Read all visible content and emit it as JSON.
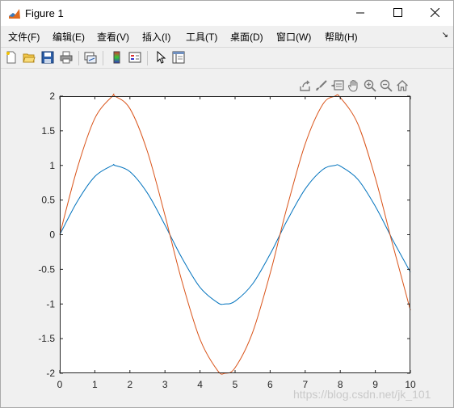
{
  "window": {
    "title": "Figure 1"
  },
  "menubar": {
    "items": [
      {
        "label": "文件(F)"
      },
      {
        "label": "编辑(E)"
      },
      {
        "label": "查看(V)"
      },
      {
        "label": "插入(I)"
      },
      {
        "label": "工具(T)"
      },
      {
        "label": "桌面(D)"
      },
      {
        "label": "窗口(W)"
      },
      {
        "label": "帮助(H)"
      }
    ],
    "overflow_icon": "dock-arrow-icon"
  },
  "toolbar": {
    "buttons": [
      "new-figure-icon",
      "open-file-icon",
      "save-icon",
      "print-icon",
      "link-plot-icon",
      "insert-colorbar-icon",
      "insert-legend-icon",
      "edit-plot-arrow-icon",
      "property-inspector-icon"
    ]
  },
  "axes_toolbar": {
    "buttons": [
      "export-icon",
      "brush-icon",
      "data-tips-icon",
      "pan-icon",
      "zoom-in-icon",
      "zoom-out-icon",
      "restore-view-icon"
    ]
  },
  "chart_data": {
    "type": "line",
    "title": "",
    "xlabel": "",
    "ylabel": "",
    "xlim": [
      0,
      10
    ],
    "ylim": [
      -2,
      2
    ],
    "x_ticks": [
      "0",
      "1",
      "2",
      "3",
      "4",
      "5",
      "6",
      "7",
      "8",
      "9",
      "10"
    ],
    "y_ticks": [
      "2",
      "1.5",
      "1",
      "0.5",
      "0",
      "-0.5",
      "-1",
      "-1.5",
      "-2"
    ],
    "grid": false,
    "series": [
      {
        "color": "#0072BD",
        "x": [
          0,
          0.5,
          1,
          1.5,
          1.57,
          2,
          2.5,
          3,
          3.14,
          3.5,
          4,
          4.5,
          4.71,
          5,
          5.5,
          6,
          6.28,
          6.5,
          7,
          7.5,
          7.85,
          8,
          8.5,
          9,
          9.42,
          9.5,
          10
        ],
        "y": [
          0,
          0.48,
          0.84,
          1.0,
          1.0,
          0.91,
          0.6,
          0.14,
          0,
          -0.35,
          -0.76,
          -0.98,
          -1.0,
          -0.96,
          -0.71,
          -0.28,
          0,
          0.22,
          0.66,
          0.94,
          1.0,
          0.99,
          0.8,
          0.41,
          0,
          -0.08,
          -0.54
        ]
      },
      {
        "color": "#D95319",
        "x": [
          0,
          0.5,
          1,
          1.5,
          1.57,
          2,
          2.5,
          3,
          3.14,
          3.5,
          4,
          4.5,
          4.71,
          5,
          5.5,
          6,
          6.28,
          6.5,
          7,
          7.5,
          7.85,
          8,
          8.5,
          9,
          9.42,
          9.5,
          10
        ],
        "y": [
          0,
          0.96,
          1.68,
          2.0,
          2.0,
          1.82,
          1.2,
          0.28,
          0,
          -0.7,
          -1.51,
          -1.96,
          -2.0,
          -1.92,
          -1.41,
          -0.56,
          0,
          0.43,
          1.31,
          1.88,
          2.0,
          1.98,
          1.6,
          0.82,
          0,
          -0.15,
          -1.09
        ]
      }
    ]
  },
  "watermark": "https://blog.csdn.net/jk_101"
}
